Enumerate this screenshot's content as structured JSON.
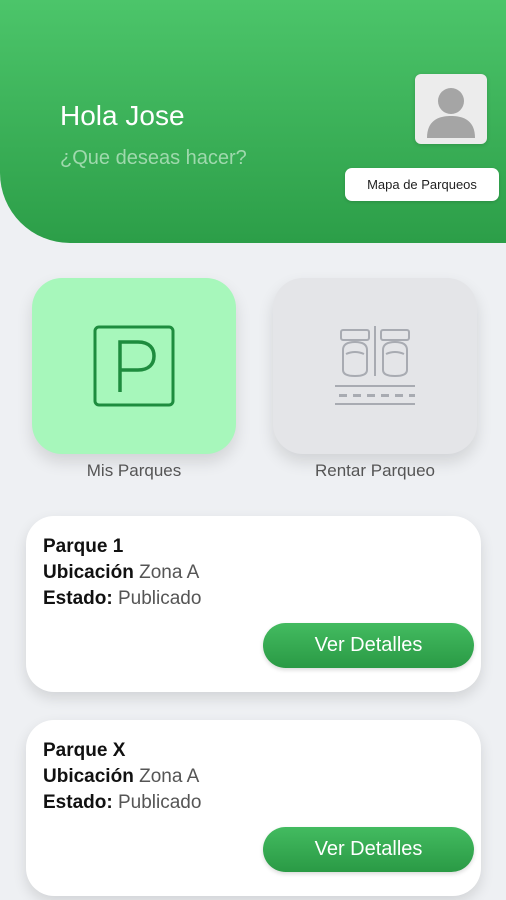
{
  "header": {
    "greeting": "Hola Jose",
    "subtitle": "¿Que deseas hacer?",
    "map_button": "Mapa de Parqueos",
    "avatar_icon": "user-avatar-icon",
    "bg_color_top": "#4cc56a",
    "bg_color_bottom": "#2c9e48"
  },
  "actions": {
    "mis_parques": {
      "label": "Mis Parques",
      "icon": "parking-p-icon",
      "color": "#a7f7bb"
    },
    "rentar_parqueo": {
      "label": "Rentar Parqueo",
      "icon": "parking-cars-icon",
      "color": "#e4e5e8"
    }
  },
  "parques": [
    {
      "name": "Parque 1",
      "ubicacion_label": "Ubicación",
      "ubicacion_value": "Zona A",
      "estado_label": "Estado:",
      "estado_value": "Publicado",
      "button": "Ver Detalles"
    },
    {
      "name": "Parque X",
      "ubicacion_label": "Ubicación",
      "ubicacion_value": "Zona A",
      "estado_label": "Estado:",
      "estado_value": "Publicado",
      "button": "Ver Detalles"
    }
  ]
}
